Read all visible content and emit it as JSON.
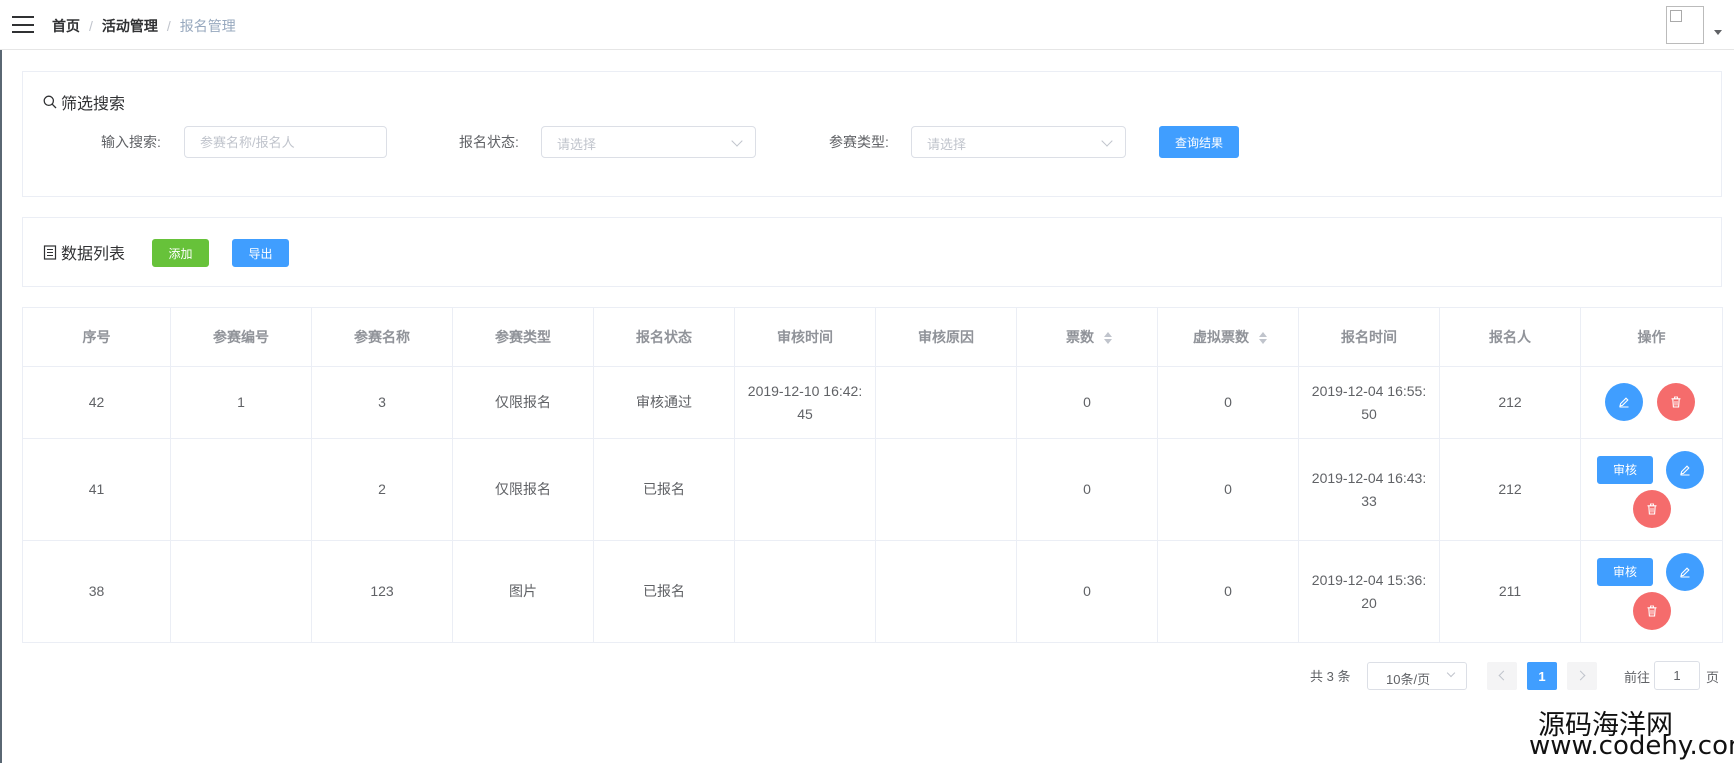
{
  "breadcrumb": {
    "home": "首页",
    "activity": "活动管理",
    "current": "报名管理",
    "separator": "/"
  },
  "filter": {
    "title": "筛选搜索",
    "search_label": "输入搜索:",
    "search_placeholder": "参赛名称/报名人",
    "status_label": "报名状态:",
    "status_placeholder": "请选择",
    "type_label": "参赛类型:",
    "type_placeholder": "请选择",
    "query_button": "查询结果"
  },
  "list": {
    "title": "数据列表",
    "add_button": "添加",
    "export_button": "导出"
  },
  "table": {
    "headers": [
      "序号",
      "参赛编号",
      "参赛名称",
      "参赛类型",
      "报名状态",
      "审核时间",
      "审核原因",
      "票数",
      "虚拟票数",
      "报名时间",
      "报名人",
      "操作"
    ],
    "sortable": [
      "票数",
      "虚拟票数"
    ],
    "audit_button": "审核",
    "rows": [
      {
        "id": "42",
        "code": "1",
        "name": "3",
        "type": "仅限报名",
        "status": "审核通过",
        "audit_time_date": "2019-12-10 16:42:",
        "audit_time_sec": "45",
        "audit_reason": "",
        "votes": "0",
        "virtual_votes": "0",
        "signup_time_date": "2019-12-04 16:55:",
        "signup_time_sec": "50",
        "user": "212"
      },
      {
        "id": "41",
        "code": "",
        "name": "2",
        "type": "仅限报名",
        "status": "已报名",
        "audit_time_date": "",
        "audit_time_sec": "",
        "audit_reason": "",
        "votes": "0",
        "virtual_votes": "0",
        "signup_time_date": "2019-12-04 16:43:",
        "signup_time_sec": "33",
        "user": "212"
      },
      {
        "id": "38",
        "code": "",
        "name": "123",
        "type": "图片",
        "status": "已报名",
        "audit_time_date": "",
        "audit_time_sec": "",
        "audit_reason": "",
        "votes": "0",
        "virtual_votes": "0",
        "signup_time_date": "2019-12-04 15:36:",
        "signup_time_sec": "20",
        "user": "211"
      }
    ]
  },
  "pagination": {
    "total": "共 3 条",
    "page_size": "10条/页",
    "current_page": "1",
    "goto_label": "前往",
    "goto_value": "1",
    "page_suffix": "页"
  },
  "watermark": {
    "line1": "源码海洋网",
    "line2": "www.codehy.com"
  },
  "icons": {
    "menu": "hamburger-icon",
    "search": "search-icon",
    "list": "document-icon",
    "edit": "edit-icon",
    "delete": "trash-icon",
    "sort": "sort-caret-icon"
  },
  "colors": {
    "primary": "#409eff",
    "success": "#67c23a",
    "danger": "#f56c6c",
    "border": "#ebeef5"
  }
}
